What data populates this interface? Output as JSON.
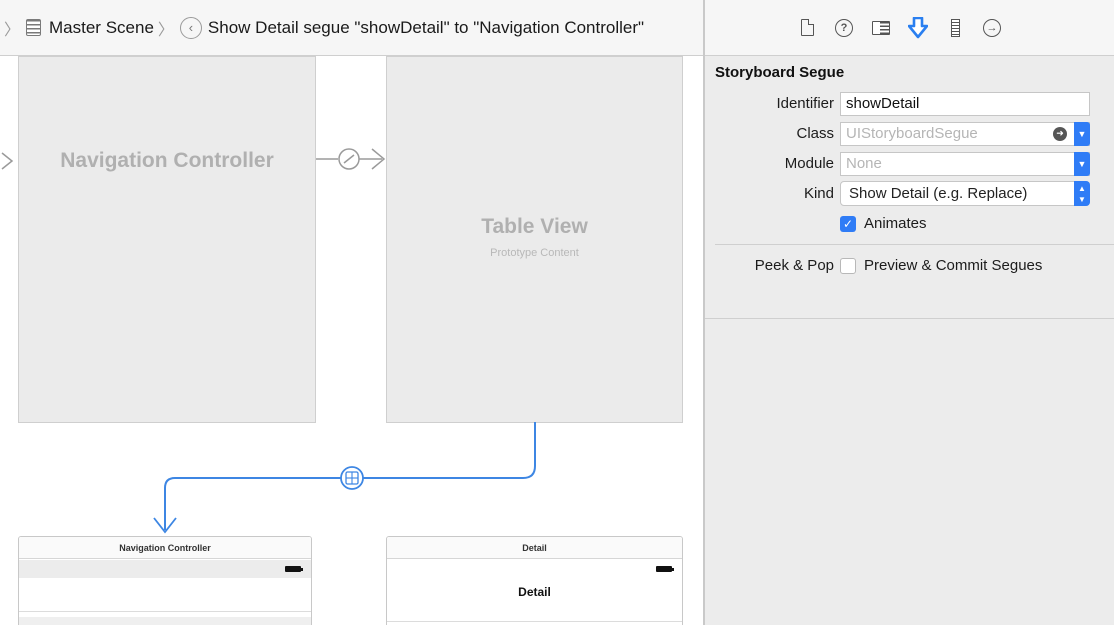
{
  "jumpbar": {
    "scene_label": "Master Scene",
    "segue_label": "Show Detail segue \"showDetail\" to \"Navigation Controller\""
  },
  "canvas": {
    "nav_scene_title": "Navigation Controller",
    "table_scene_title": "Table View",
    "table_scene_subtitle": "Prototype Content",
    "mini_nav_title": "Navigation Controller",
    "mini_detail_header": "Detail",
    "mini_detail_title": "Detail"
  },
  "inspector": {
    "tabs": [
      "file-inspector",
      "quick-help",
      "identity-inspector",
      "attributes-inspector",
      "size-inspector",
      "connections-inspector"
    ],
    "active_tab": "attributes-inspector",
    "section_title": "Storyboard Segue",
    "identifier_label": "Identifier",
    "identifier_value": "showDetail",
    "class_label": "Class",
    "class_placeholder": "UIStoryboardSegue",
    "module_label": "Module",
    "module_placeholder": "None",
    "kind_label": "Kind",
    "kind_value": "Show Detail (e.g. Replace)",
    "animates_label": "Animates",
    "animates_checked": true,
    "peek_label": "Peek & Pop",
    "peek_option_label": "Preview & Commit Segues",
    "peek_checked": false,
    "accent_color": "#2f7cf6"
  }
}
